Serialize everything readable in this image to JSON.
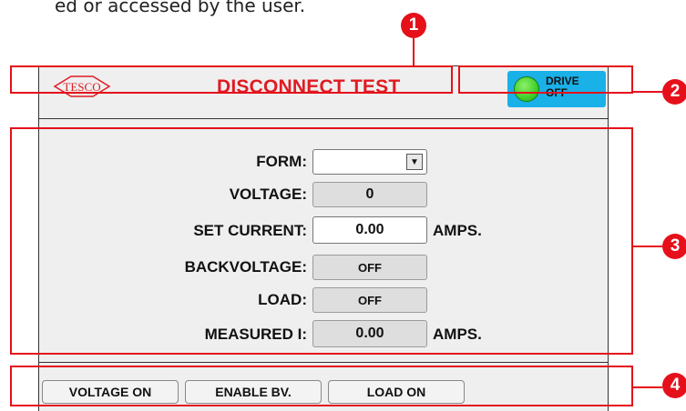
{
  "intro_text": "ed or accessed by the user.",
  "header": {
    "title": "DISCONNECT TEST",
    "logo_text": "TESCO",
    "drive_status": {
      "line1": "DRIVE",
      "line2": "OFF"
    }
  },
  "callouts": [
    "1",
    "2",
    "3",
    "4"
  ],
  "form": {
    "rows": [
      {
        "label": "FORM:",
        "value": "",
        "unit": ""
      },
      {
        "label": "VOLTAGE:",
        "value": "0",
        "unit": ""
      },
      {
        "label": "SET CURRENT:",
        "value": "0.00",
        "unit": "AMPS."
      },
      {
        "label": "BACKVOLTAGE:",
        "value": "OFF",
        "unit": ""
      },
      {
        "label": "LOAD:",
        "value": "OFF",
        "unit": ""
      },
      {
        "label": "MEASURED I:",
        "value": "0.00",
        "unit": "AMPS."
      }
    ]
  },
  "buttons": {
    "voltage_on": "VOLTAGE ON",
    "enable_bv": "ENABLE BV.",
    "load_on": "LOAD ON"
  },
  "colors": {
    "callout_red": "#e5101a",
    "title_red": "#e01b22",
    "drive_blue": "#1ab0e8",
    "led_green": "#3fcf2a"
  }
}
